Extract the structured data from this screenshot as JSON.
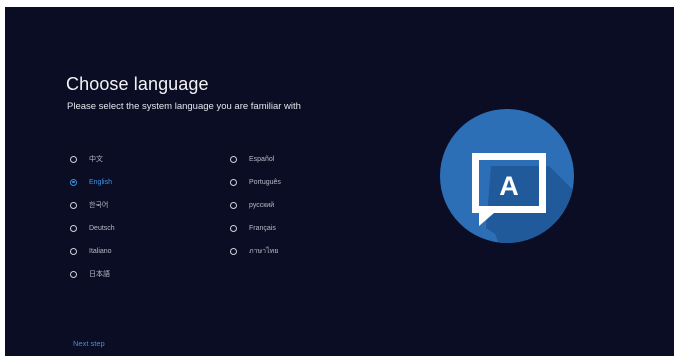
{
  "header": {
    "title": "Choose language",
    "subtitle": "Please select the system language you are familiar with"
  },
  "languages": {
    "left": [
      {
        "label": "中文",
        "selected": false
      },
      {
        "label": "English",
        "selected": true
      },
      {
        "label": "한국어",
        "selected": false
      },
      {
        "label": "Deutsch",
        "selected": false
      },
      {
        "label": "Italiano",
        "selected": false
      },
      {
        "label": "日本語",
        "selected": false
      }
    ],
    "right": [
      {
        "label": "Español",
        "selected": false
      },
      {
        "label": "Português",
        "selected": false
      },
      {
        "label": "русский",
        "selected": false
      },
      {
        "label": "Français",
        "selected": false
      },
      {
        "label": "ภาษาไทย",
        "selected": false
      }
    ]
  },
  "logo": {
    "icon": "language-chat-icon",
    "letter": "A"
  },
  "footer": {
    "next_label": "Next step"
  },
  "colors": {
    "background": "#0b0d24",
    "accent": "#2f8fe0",
    "logo_circle": "#2c6fb7"
  }
}
